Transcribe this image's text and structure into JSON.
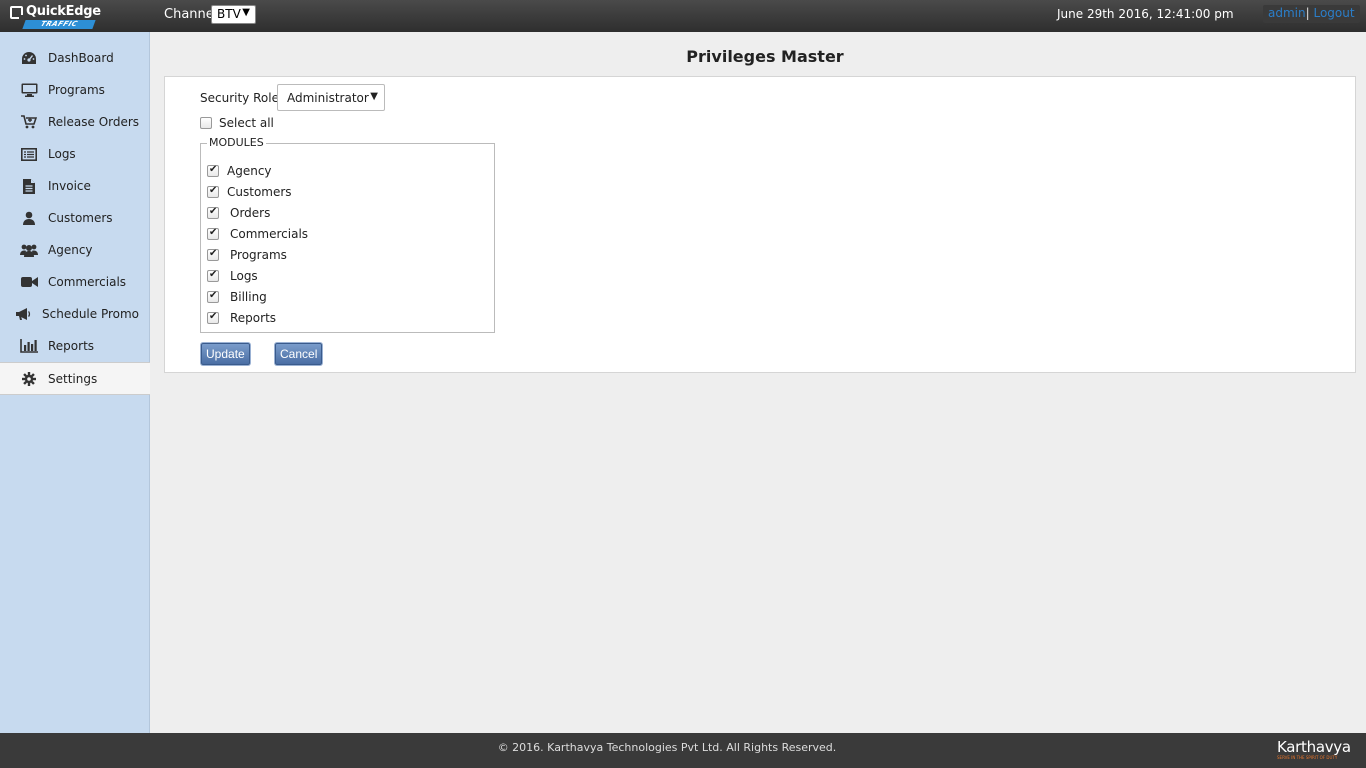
{
  "header": {
    "logo_text": "QuickEdge",
    "logo_sub": "TRAFFIC",
    "channel_label": "Channel",
    "channel_value": "BTV",
    "datetime": "June 29th 2016, 12:41:00 pm",
    "user": "admin",
    "separator": "|",
    "logout": "Logout"
  },
  "sidebar": {
    "items": [
      {
        "label": "DashBoard",
        "icon": "dashboard-icon"
      },
      {
        "label": "Programs",
        "icon": "monitor-icon"
      },
      {
        "label": "Release Orders",
        "icon": "cart-icon"
      },
      {
        "label": "Logs",
        "icon": "list-icon"
      },
      {
        "label": "Invoice",
        "icon": "document-icon"
      },
      {
        "label": "Customers",
        "icon": "user-icon"
      },
      {
        "label": "Agency",
        "icon": "users-icon"
      },
      {
        "label": "Commercials",
        "icon": "video-camera-icon"
      },
      {
        "label": "Schedule Promo",
        "icon": "megaphone-icon"
      },
      {
        "label": "Reports",
        "icon": "bar-chart-icon"
      },
      {
        "label": "Settings",
        "icon": "gear-icon",
        "active": true
      }
    ]
  },
  "main": {
    "title": "Privileges Master",
    "security_role_label": "Security Role:",
    "security_role_value": "Administrator",
    "select_all_label": "Select all",
    "select_all_checked": false,
    "modules_legend": "MODULES",
    "modules": [
      {
        "label": "Agency",
        "checked": true
      },
      {
        "label": "Customers",
        "checked": true
      },
      {
        "label": "Orders",
        "checked": true
      },
      {
        "label": "Commercials",
        "checked": true
      },
      {
        "label": "Programs",
        "checked": true
      },
      {
        "label": "Logs",
        "checked": true
      },
      {
        "label": "Billing",
        "checked": true
      },
      {
        "label": "Reports",
        "checked": true
      }
    ],
    "update_label": "Update",
    "cancel_label": "Cancel"
  },
  "footer": {
    "copyright": "© 2016. Karthavya Technologies Pvt Ltd. All Rights Reserved.",
    "brand": "Karthavya",
    "brand_tagline": "SERVE IN THE SPIRIT OF DUTY"
  },
  "colors": {
    "sidebar_bg": "#c7daef",
    "link_blue": "#2b7ec9",
    "button_blue": "#4a6ea4",
    "brand_orange": "#e8752b"
  }
}
